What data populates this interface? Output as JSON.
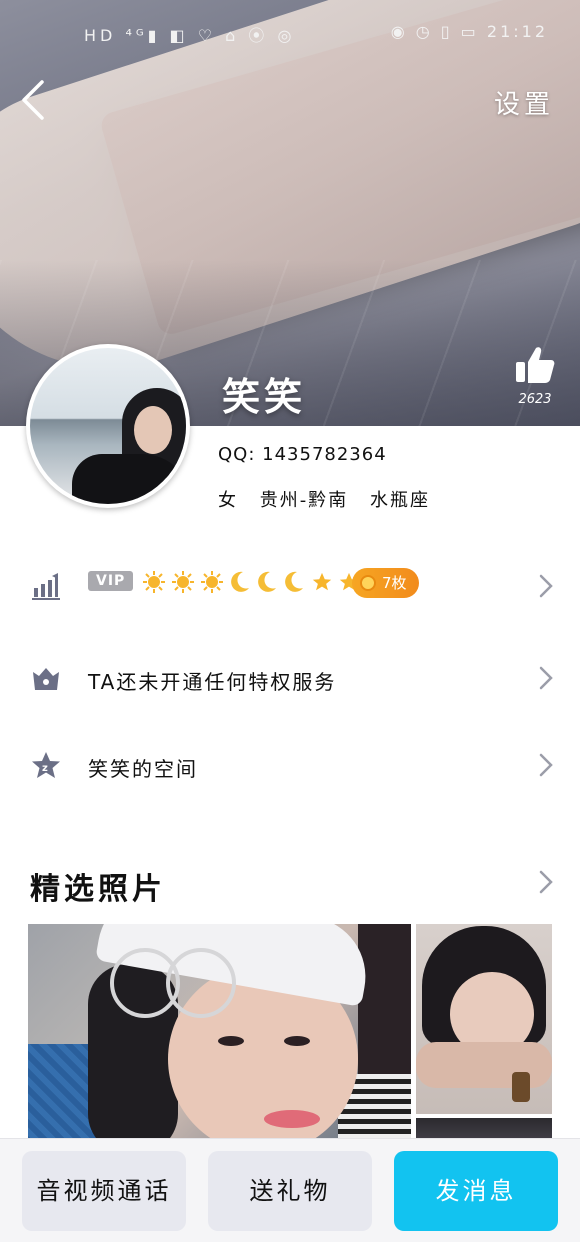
{
  "status_bar": {
    "left_indicators": "HD ⁴ᴳ▮ ◧ ♡ ⌂ ⦿ ◎",
    "right_indicators": "◉ ◷ ▯ ▭",
    "time": "21:12"
  },
  "header": {
    "settings_label": "设置",
    "nickname": "笑笑",
    "like_count": "2623"
  },
  "profile": {
    "qq_label": "QQ:",
    "qq_number": "1435782364",
    "gender": "女",
    "location": "贵州-黔南",
    "zodiac": "水瓶座"
  },
  "rows": {
    "vip": {
      "badge": "VIP",
      "level_icons": [
        "sun",
        "sun",
        "sun",
        "moon",
        "moon",
        "moon",
        "star",
        "star"
      ],
      "coins": "7枚"
    },
    "privilege": {
      "label": "TA还未开通任何特权服务"
    },
    "space": {
      "label": "笑笑的空间"
    }
  },
  "photos": {
    "title": "精选照片"
  },
  "actions": {
    "video_call": "音视频通话",
    "send_gift": "送礼物",
    "send_message": "发消息"
  },
  "colors": {
    "accent_blue": "#12c3f0",
    "coin_orange": "#f6a623",
    "vip_gray": "#a9a9ae",
    "icon_gray": "#6b6f86"
  }
}
